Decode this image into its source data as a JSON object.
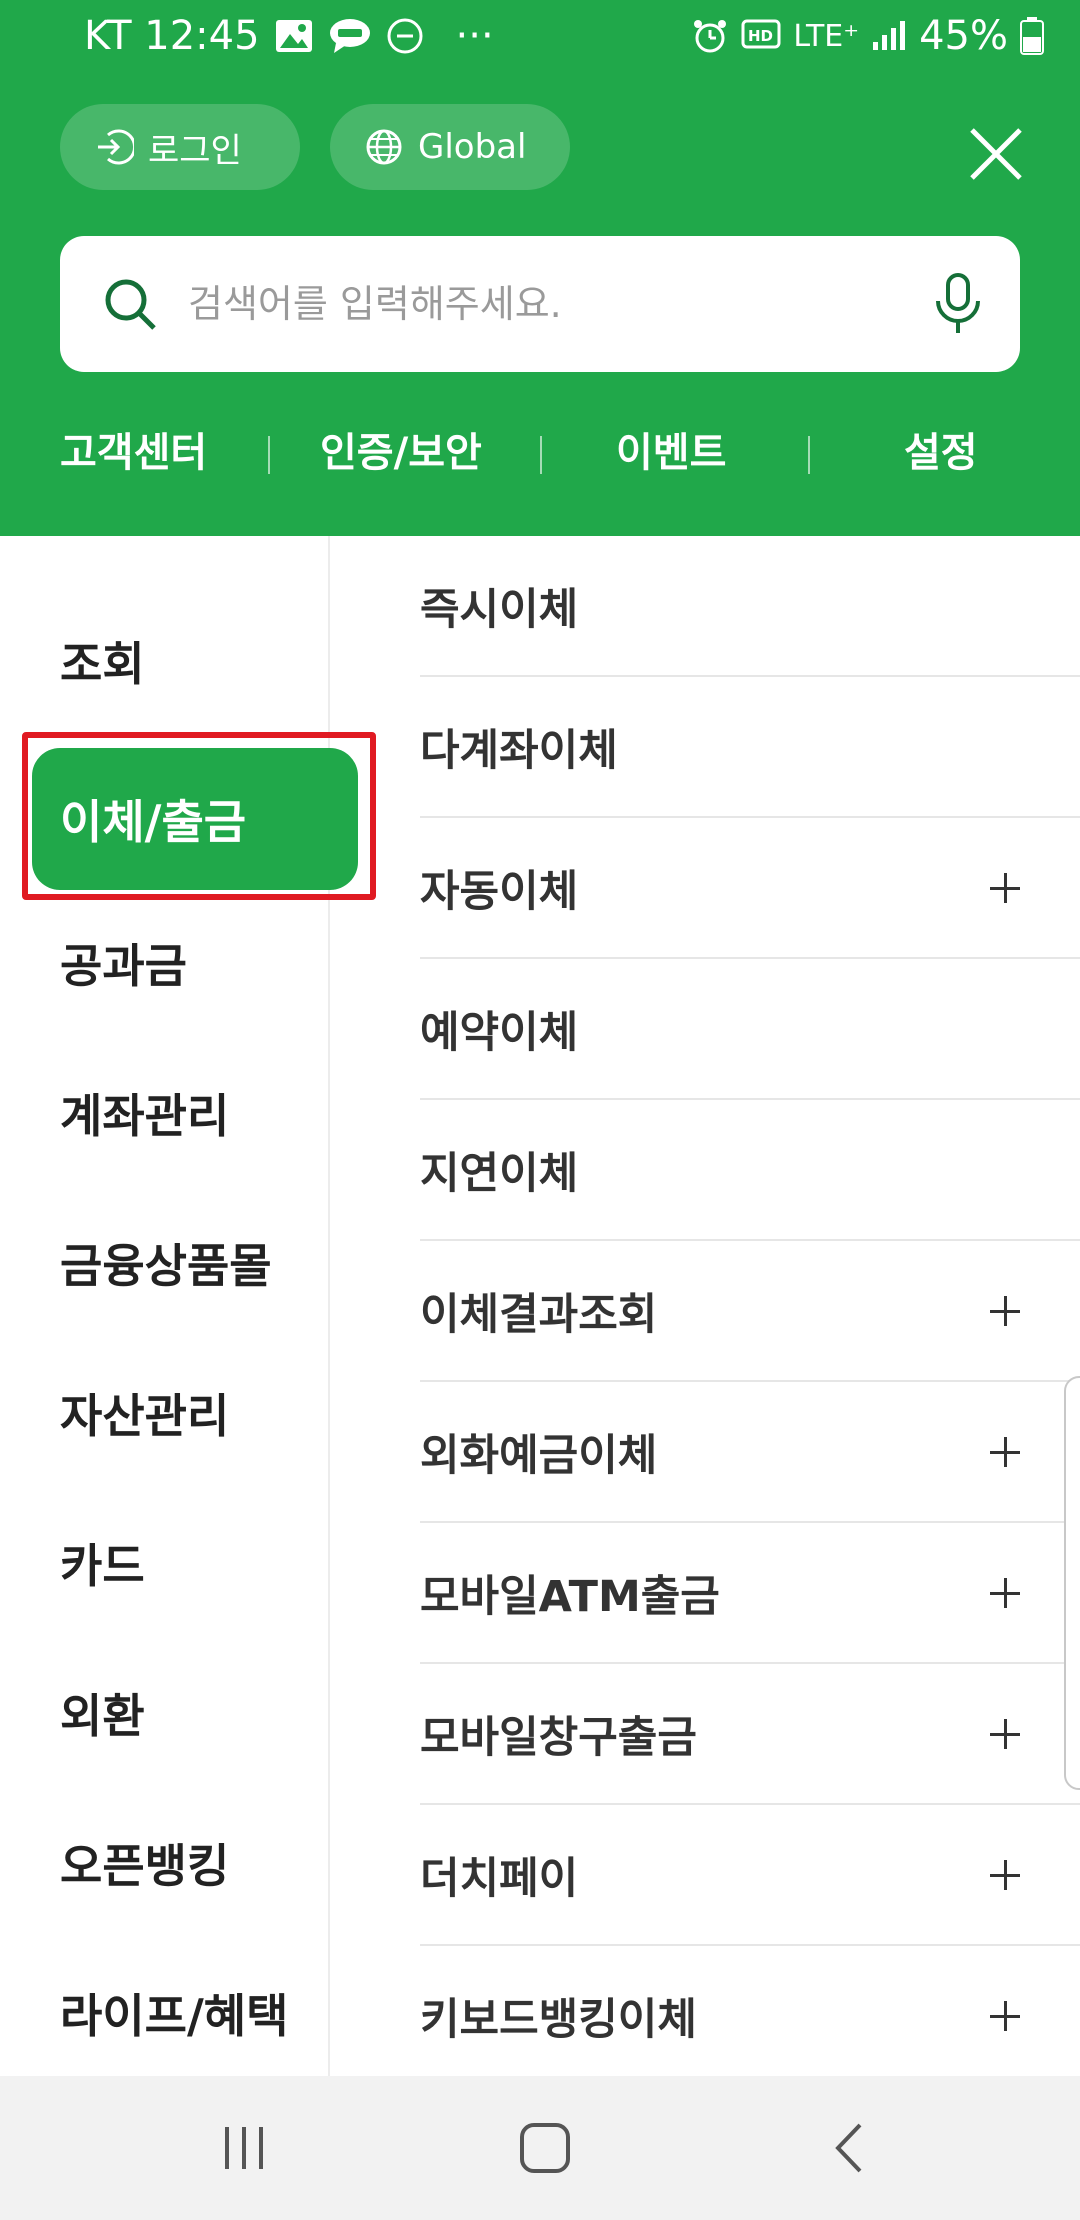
{
  "status_bar": {
    "carrier_time": "KT 12:45",
    "more": "···",
    "network": "LTE⁺",
    "battery": "45%"
  },
  "header": {
    "login_label": "로그인",
    "global_label": "Global",
    "search_placeholder": "검색어를 입력해주세요.",
    "quick_links": [
      "고객센터",
      "인증/보안",
      "이벤트",
      "설정"
    ]
  },
  "categories": [
    "조회",
    "이체/출금",
    "공과금",
    "계좌관리",
    "금융상품몰",
    "자산관리",
    "카드",
    "외환",
    "오픈뱅킹",
    "라이프/혜택"
  ],
  "active_category": "이체/출금",
  "menu_items": [
    {
      "label": "즉시이체",
      "expandable": false
    },
    {
      "label": "다계좌이체",
      "expandable": false
    },
    {
      "label": "자동이체",
      "expandable": true
    },
    {
      "label": "예약이체",
      "expandable": false
    },
    {
      "label": "지연이체",
      "expandable": false
    },
    {
      "label": "이체결과조회",
      "expandable": true
    },
    {
      "label": "외화예금이체",
      "expandable": true
    },
    {
      "label": "모바일ATM출금",
      "expandable": true
    },
    {
      "label": "모바일창구출금",
      "expandable": true
    },
    {
      "label": "더치페이",
      "expandable": true
    },
    {
      "label": "키보드뱅킹이체",
      "expandable": true
    }
  ],
  "colors": {
    "brand_green": "#20a84a",
    "highlight_red": "#e01a22"
  },
  "icons": {
    "close": "close-icon",
    "search": "search-icon",
    "mic": "microphone-icon",
    "login": "login-arrow-icon",
    "global": "globe-icon"
  }
}
